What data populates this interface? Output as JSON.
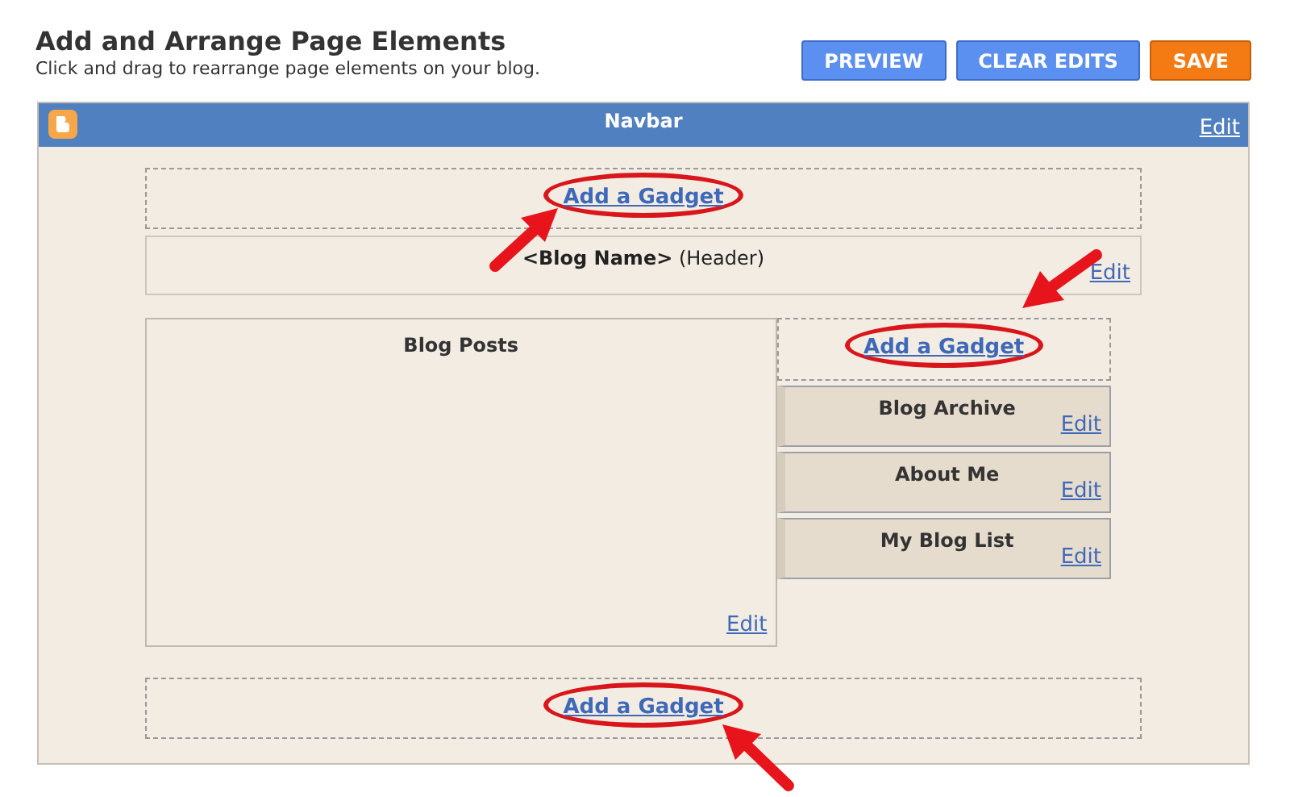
{
  "page": {
    "title": "Add and Arrange Page Elements",
    "subtitle": "Click and drag to rearrange page elements on your blog."
  },
  "buttons": [
    {
      "label": "PREVIEW",
      "kind": "secondary"
    },
    {
      "label": "CLEAR EDITS",
      "kind": "secondary"
    },
    {
      "label": "SAVE",
      "kind": "primary"
    }
  ],
  "navbar": {
    "title": "Navbar",
    "edit": "Edit"
  },
  "top_gadget": {
    "link": "Add a Gadget"
  },
  "header_section": {
    "title": "**<Blog Name>** (Header)",
    "edit": "Edit"
  },
  "blog_posts": {
    "title": "Blog Posts",
    "edit": "Edit"
  },
  "sidebar": {
    "add_gadget": "Add a Gadget",
    "widgets": [
      {
        "title": "Blog Archive",
        "edit": "Edit"
      },
      {
        "title": "About Me",
        "edit": "Edit"
      },
      {
        "title": "My Blog List",
        "edit": "Edit"
      }
    ]
  },
  "bottom_gadget": {
    "link": "Add a Gadget"
  }
}
